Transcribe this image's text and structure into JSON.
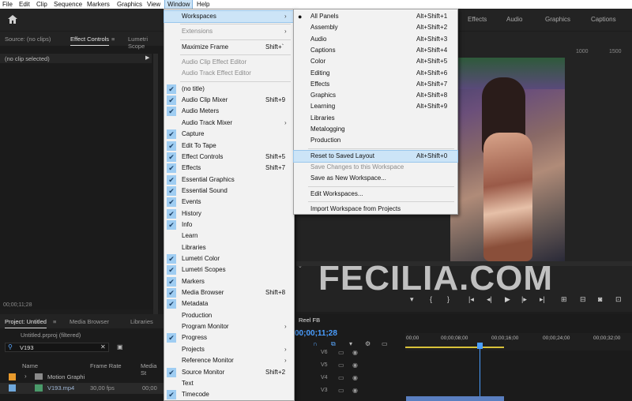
{
  "menubar": {
    "items": [
      "File",
      "Edit",
      "Clip",
      "Sequence",
      "Markers",
      "Graphics",
      "View",
      "Window",
      "Help"
    ]
  },
  "workspace_tabs": [
    "Effects",
    "Audio",
    "Graphics",
    "Captions"
  ],
  "source_panel": {
    "tabs": [
      "Source: (no clips)",
      "Effect Controls",
      "Lumetri Scope"
    ],
    "no_clip": "(no clip selected)",
    "timecode": "00;00;11;28"
  },
  "project_panel": {
    "tabs": [
      "Project: Untitled",
      "Media Browser",
      "Libraries"
    ],
    "project_file": "Untitled.prproj (filtered)",
    "search_value": "V193",
    "columns": [
      "Name",
      "Frame Rate",
      "Media St"
    ],
    "rows": [
      {
        "name": "Motion Graphi",
        "rate": ""
      },
      {
        "name": "V193.mp4",
        "rate": "30,00 fps",
        "media": "00;00"
      }
    ]
  },
  "program": {
    "ruler": [
      "1000",
      "1500"
    ],
    "watermark": "FECILIA.COM"
  },
  "timeline": {
    "title": "Reel FB",
    "timecode": "00;00;11;28",
    "ruler": [
      "00;00",
      "00;00;08;00",
      "00;00;16;00",
      "00;00;24;00",
      "00;00;32;00"
    ],
    "tracks": [
      "V6",
      "V5",
      "V4",
      "V3"
    ]
  },
  "window_menu": [
    {
      "label": "Workspaces",
      "submenu": true,
      "highlighted": true
    },
    {
      "sep": true
    },
    {
      "label": "Extensions",
      "submenu": true,
      "disabled": true
    },
    {
      "sep": true
    },
    {
      "label": "Maximize Frame",
      "shortcut": "Shift+`"
    },
    {
      "sep": true
    },
    {
      "label": "Audio Clip Effect Editor",
      "disabled": true
    },
    {
      "label": "Audio Track Effect Editor",
      "disabled": true
    },
    {
      "sep": true
    },
    {
      "label": "(no title)",
      "checked": true
    },
    {
      "label": "Audio Clip Mixer",
      "checked": true,
      "shortcut": "Shift+9"
    },
    {
      "label": "Audio Meters",
      "checked": true
    },
    {
      "label": "Audio Track Mixer",
      "submenu": true
    },
    {
      "label": "Capture",
      "checked": true
    },
    {
      "label": "Edit To Tape",
      "checked": true
    },
    {
      "label": "Effect Controls",
      "checked": true,
      "shortcut": "Shift+5"
    },
    {
      "label": "Effects",
      "checked": true,
      "shortcut": "Shift+7"
    },
    {
      "label": "Essential Graphics",
      "checked": true
    },
    {
      "label": "Essential Sound",
      "checked": true
    },
    {
      "label": "Events",
      "checked": true
    },
    {
      "label": "History",
      "checked": true
    },
    {
      "label": "Info",
      "checked": true
    },
    {
      "label": "Learn"
    },
    {
      "label": "Libraries"
    },
    {
      "label": "Lumetri Color",
      "checked": true
    },
    {
      "label": "Lumetri Scopes",
      "checked": true
    },
    {
      "label": "Markers",
      "checked": true
    },
    {
      "label": "Media Browser",
      "checked": true,
      "shortcut": "Shift+8"
    },
    {
      "label": "Metadata",
      "checked": true
    },
    {
      "label": "Production"
    },
    {
      "label": "Program Monitor",
      "submenu": true
    },
    {
      "label": "Progress",
      "checked": true
    },
    {
      "label": "Projects",
      "submenu": true
    },
    {
      "label": "Reference Monitor",
      "submenu": true
    },
    {
      "label": "Source Monitor",
      "checked": true,
      "shortcut": "Shift+2"
    },
    {
      "label": "Text"
    },
    {
      "label": "Timecode",
      "checked": true
    }
  ],
  "workspaces_menu": [
    {
      "label": "All Panels",
      "shortcut": "Alt+Shift+1",
      "bullet": true
    },
    {
      "label": "Assembly",
      "shortcut": "Alt+Shift+2"
    },
    {
      "label": "Audio",
      "shortcut": "Alt+Shift+3"
    },
    {
      "label": "Captions",
      "shortcut": "Alt+Shift+4"
    },
    {
      "label": "Color",
      "shortcut": "Alt+Shift+5"
    },
    {
      "label": "Editing",
      "shortcut": "Alt+Shift+6"
    },
    {
      "label": "Effects",
      "shortcut": "Alt+Shift+7"
    },
    {
      "label": "Graphics",
      "shortcut": "Alt+Shift+8"
    },
    {
      "label": "Learning",
      "shortcut": "Alt+Shift+9"
    },
    {
      "label": "Libraries"
    },
    {
      "label": "Metalogging"
    },
    {
      "label": "Production"
    },
    {
      "sep": true
    },
    {
      "label": "Reset to Saved Layout",
      "shortcut": "Alt+Shift+0",
      "highlighted": true
    },
    {
      "label": "Save Changes to this Workspace",
      "disabled": true
    },
    {
      "label": "Save as New Workspace..."
    },
    {
      "sep": true
    },
    {
      "label": "Edit Workspaces..."
    },
    {
      "sep": true
    },
    {
      "label": "Import Workspace from Projects"
    }
  ],
  "colors": {
    "menu_bg": "#f2f2f2",
    "highlight": "#cce4f7",
    "check_bg": "#9fcdf2",
    "timeline_blue": "#2d8ceb",
    "playhead": "#4a9eff"
  }
}
